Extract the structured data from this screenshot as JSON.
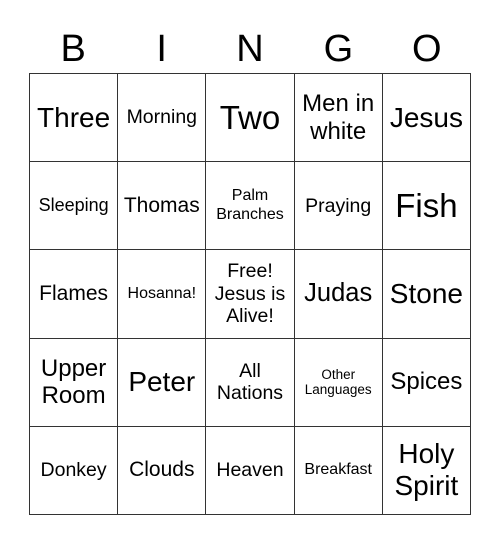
{
  "header": {
    "letters": [
      "B",
      "I",
      "N",
      "G",
      "O"
    ]
  },
  "grid": {
    "rows": [
      [
        {
          "text": "Three",
          "size": "s28"
        },
        {
          "text": "Morning",
          "size": "s19"
        },
        {
          "text": "Two",
          "size": "s33"
        },
        {
          "text": "Men in white",
          "size": "s24"
        },
        {
          "text": "Jesus",
          "size": "s28"
        }
      ],
      [
        {
          "text": "Sleeping",
          "size": "s18"
        },
        {
          "text": "Thomas",
          "size": "s21"
        },
        {
          "text": "Palm Branches",
          "size": "s16"
        },
        {
          "text": "Praying",
          "size": "s19"
        },
        {
          "text": "Fish",
          "size": "s33"
        }
      ],
      [
        {
          "text": "Flames",
          "size": "s21"
        },
        {
          "text": "Hosanna!",
          "size": "s16"
        },
        {
          "text": "Free! Jesus is Alive!",
          "size": "s19"
        },
        {
          "text": "Judas",
          "size": "s25"
        },
        {
          "text": "Stone",
          "size": "s28"
        }
      ],
      [
        {
          "text": "Upper Room",
          "size": "s24"
        },
        {
          "text": "Peter",
          "size": "s28"
        },
        {
          "text": "All Nations",
          "size": "s19"
        },
        {
          "text": "Other Languages",
          "size": "s13"
        },
        {
          "text": "Spices",
          "size": "s24"
        }
      ],
      [
        {
          "text": "Donkey",
          "size": "s19"
        },
        {
          "text": "Clouds",
          "size": "s21"
        },
        {
          "text": "Heaven",
          "size": "s19"
        },
        {
          "text": "Breakfast",
          "size": "s16"
        },
        {
          "text": "Holy Spirit",
          "size": "s28"
        }
      ]
    ]
  }
}
